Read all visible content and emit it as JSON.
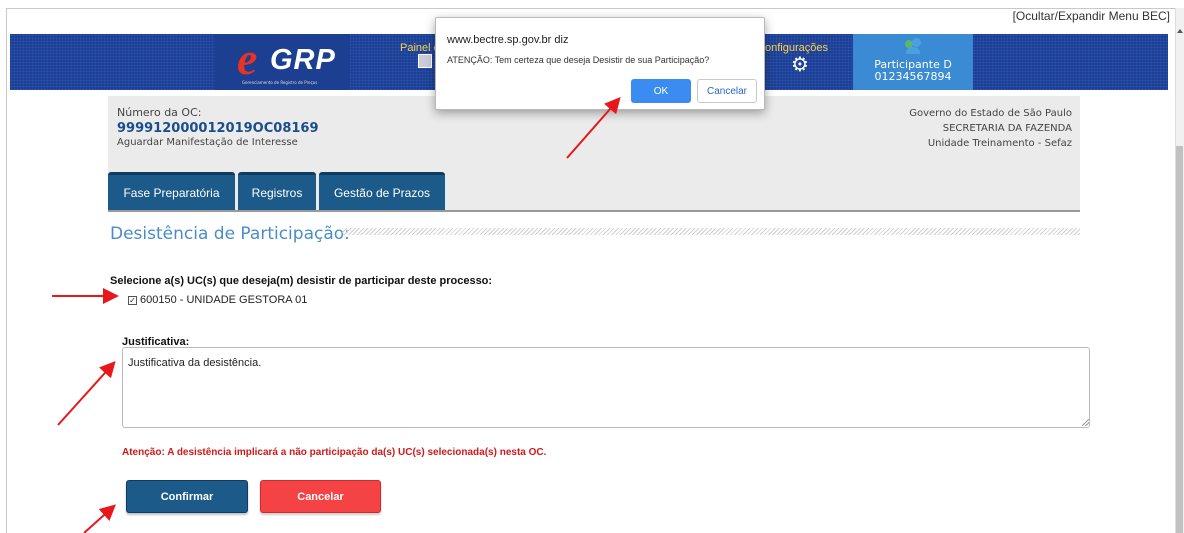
{
  "top_bar": {
    "toggle_menu_label": "[Ocultar/Expandir Menu BEC]"
  },
  "header": {
    "logo_e": "e",
    "logo_text": "GRP",
    "logo_subtitle": "Gerenciamento de Registro de Preços",
    "menu_painel_label": "Painel c",
    "menu_config_label": "onfigurações",
    "user_name": "Participante D",
    "user_id": "01234567894"
  },
  "oc_panel": {
    "number_label": "Número da OC:",
    "number": "999912000012019OC08169",
    "status": "Aguardar Manifestação de Interesse",
    "org_line1": "Governo do Estado de São Paulo",
    "org_line2": "SECRETARIA DA FAZENDA",
    "org_line3": "Unidade Treinamento - Sefaz"
  },
  "tabs": [
    {
      "label": "Fase Preparatória"
    },
    {
      "label": "Registros"
    },
    {
      "label": "Gestão de Prazos"
    }
  ],
  "section": {
    "title": "Desistência de Participação:"
  },
  "form": {
    "select_label": "Selecione a(s) UC(s) que deseja(m) desistir de participar deste processo:",
    "uc_item_label": "600150 - UNIDADE GESTORA 01",
    "uc_item_checked": true,
    "justification_label": "Justificativa:",
    "justification_value": "Justificativa da desistência.",
    "warning": "Atenção: A desistência implicará a não participação da(s) UC(s) selecionada(s) nesta OC.",
    "confirm_label": "Confirmar",
    "cancel_label": "Cancelar"
  },
  "dialog": {
    "origin": "www.bectre.sp.gov.br diz",
    "message": "ATENÇÃO: Tem certeza que deseja Desistir de sua Participação?",
    "ok_label": "OK",
    "cancel_label": "Cancelar"
  },
  "colors": {
    "header_blue": "#1d3f92",
    "tab_blue": "#1b5a89",
    "title_blue": "#4a8ccb",
    "warning_red": "#d0181a",
    "cancel_red": "#f44245",
    "dialog_ok_blue": "#3b8cf0",
    "annotation_arrow": "#e8171b"
  },
  "icons": [
    "calendar-icon",
    "gear-icon",
    "user-group-icon",
    "checkbox-icon",
    "resize-grip-icon",
    "annotation-arrow-icon"
  ]
}
